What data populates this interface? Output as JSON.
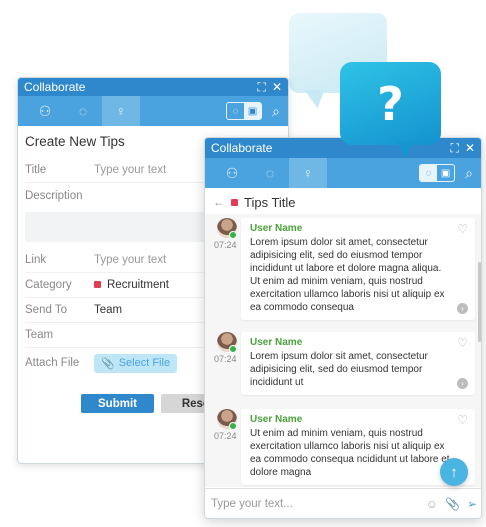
{
  "back_window": {
    "title": "Collaborate",
    "form": {
      "heading": "Create New Tips",
      "fields": [
        {
          "label": "Title",
          "value": "Type your text"
        },
        {
          "label": "Description",
          "value": ""
        },
        {
          "label": "Link",
          "value": "Type your text"
        },
        {
          "label": "Category",
          "value": "Recruitment"
        },
        {
          "label": "Send To",
          "value": "Team"
        },
        {
          "label": "Team",
          "value": ""
        },
        {
          "label": "Attach File",
          "value": "Select File"
        }
      ],
      "submit_label": "Submit",
      "reset_label": "Reset"
    }
  },
  "front_window": {
    "title": "Collaborate",
    "tips_title": "Tips Title",
    "messages": [
      {
        "user": "User Name",
        "time": "07:24",
        "text": "Lorem ipsum dolor sit amet, consectetur adipisicing elit, sed do eiusmod tempor incididunt ut labore et dolore magna aliqua. Ut enim ad minim veniam, quis nostrud exercitation ullamco laboris nisi ut aliquip ex ea commodo consequa"
      },
      {
        "user": "User Name",
        "time": "07:24",
        "text": "Lorem ipsum dolor sit amet, consectetur adipisicing elit, sed do eiusmod tempor incididunt ut"
      },
      {
        "user": "User Name",
        "time": "07:24",
        "text": "Ut enim ad minim veniam, quis nostrud exercitation ullamco laboris nisi ut aliquip ex ea commodo consequa ncididunt ut labore et dolore magna"
      }
    ],
    "composer_placeholder": "Type your text..."
  },
  "colors": {
    "primary": "#2f88cc",
    "toolbar": "#4aa3de",
    "accent_green": "#4aa33a",
    "category_red": "#e33d54"
  }
}
